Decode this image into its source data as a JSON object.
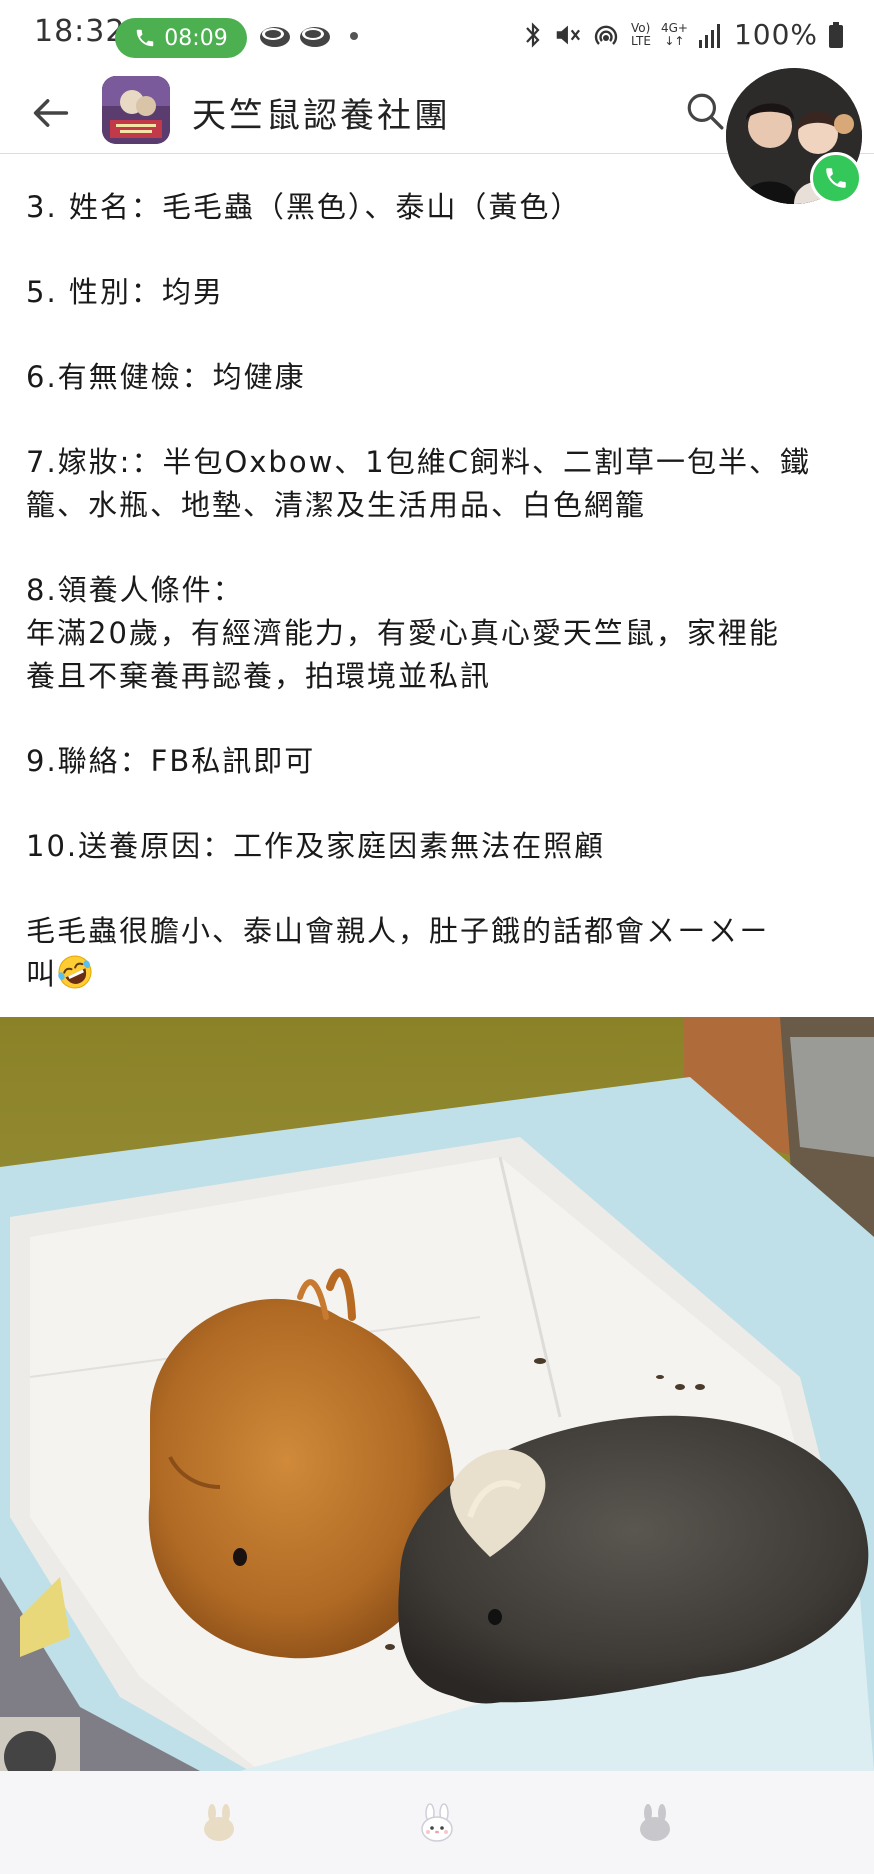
{
  "status_bar": {
    "time": "18:32",
    "call_duration": "08:09",
    "battery": "100%",
    "network_label_top": "Vo)",
    "network_label_bottom": "LTE",
    "network_gen": "4G+"
  },
  "header": {
    "title": "天竺鼠認養社團",
    "back_icon": "arrow-left-icon",
    "search_icon": "search-icon"
  },
  "post": {
    "lines": [
      "3. 姓名：毛毛蟲（黑色）、泰山（黃色）",
      "5. 性別：均男",
      "6.有無健檢：均健康",
      "7.嫁妝:：半包Oxbow、1包維C飼料、二割草一包半、鐵",
      "籠、水瓶、地墊、清潔及生活用品、白色網籠",
      "8.領養人條件：",
      "年滿20歲，有經濟能力，有愛心真心愛天竺鼠，家裡能",
      "養且不棄養再認養，拍環境並私訊",
      "9.聯絡：FB私訊即可",
      "10.送養原因：工作及家庭因素無法在照顧",
      "毛毛蟲很膽小、泰山會親人，肚子餓的話都會ㄨㄧㄨㄧ",
      "叫"
    ],
    "emoji": "rolling-on-floor-laughing-emoji"
  },
  "photo": {
    "subject": "two-guinea-pigs-photo"
  },
  "bottom_nav": {
    "items": [
      "bunny-icon",
      "bunny-face-icon",
      "bunny-icon"
    ]
  },
  "colors": {
    "call_green": "#4caf50",
    "bubble_phone_green": "#34c759",
    "nav_bg": "#f6f6f8"
  }
}
